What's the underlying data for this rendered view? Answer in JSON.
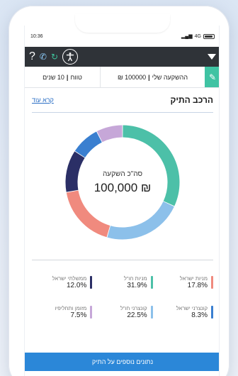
{
  "status_bar": {
    "time": "10:36",
    "network": "4G",
    "signal_icon": "signal-bars-icon",
    "battery_icon": "battery-icon"
  },
  "topbar": {
    "help_label": "?",
    "icons": [
      "help-icon",
      "phone-icon",
      "refresh-icon",
      "accessibility-icon",
      "dropdown-triangle-icon"
    ],
    "background": "#2f3338"
  },
  "info_row": {
    "investment_label": "ההשקעה שלי",
    "investment_value": "100000 ₪",
    "term_label": "טווח",
    "term_value": "10 שנים",
    "edit_color": "#3fc3a3"
  },
  "section": {
    "title": "הרכב התיק",
    "read_more": "קרא עוד"
  },
  "donut": {
    "center_label": "סה\"כ השקעה",
    "center_value": "100,000 ₪"
  },
  "chart_data": {
    "type": "pie",
    "center_label": "סה\"כ השקעה",
    "center_value": "100,000 ₪",
    "slices": [
      {
        "name": "מניות ישראל",
        "value": 17.8,
        "color": "#f08a7e"
      },
      {
        "name": "מניות חו\"ל",
        "value": 31.9,
        "color": "#4cc0a8"
      },
      {
        "name": "ממשלתי ישראל",
        "value": 12.0,
        "color": "#2b2f66"
      },
      {
        "name": "קונצרני ישראל",
        "value": 8.3,
        "color": "#3a7fd0"
      },
      {
        "name": "קונצרני חו\"ל",
        "value": 22.5,
        "color": "#8cc0ea"
      },
      {
        "name": "מזומן ותחליפיו",
        "value": 7.5,
        "color": "#c6a7d8"
      }
    ],
    "ring_order_clockwise_from_top": [
      "מניות חו\"ל",
      "קונצרני חו\"ל",
      "מניות ישראל",
      "ממשלתי ישראל",
      "קונצרני ישראל",
      "מזומן ותחליפיו"
    ]
  },
  "legend": [
    {
      "name": "מניות ישראל",
      "pct": "17.8%",
      "color": "#f08a7e"
    },
    {
      "name": "מניות חו\"ל",
      "pct": "31.9%",
      "color": "#4cc0a8"
    },
    {
      "name": "ממשלתי ישראל",
      "pct": "12.0%",
      "color": "#2b2f66"
    },
    {
      "name": "קונצרני ישראל",
      "pct": "8.3%",
      "color": "#3a7fd0"
    },
    {
      "name": "קונצרני חו\"ל",
      "pct": "22.5%",
      "color": "#8cc0ea"
    },
    {
      "name": "מזומן ותחליפיו",
      "pct": "7.5%",
      "color": "#c6a7d8"
    }
  ],
  "cta": {
    "label": "נתונים נוספים על התיק",
    "color": "#2b87d8"
  }
}
